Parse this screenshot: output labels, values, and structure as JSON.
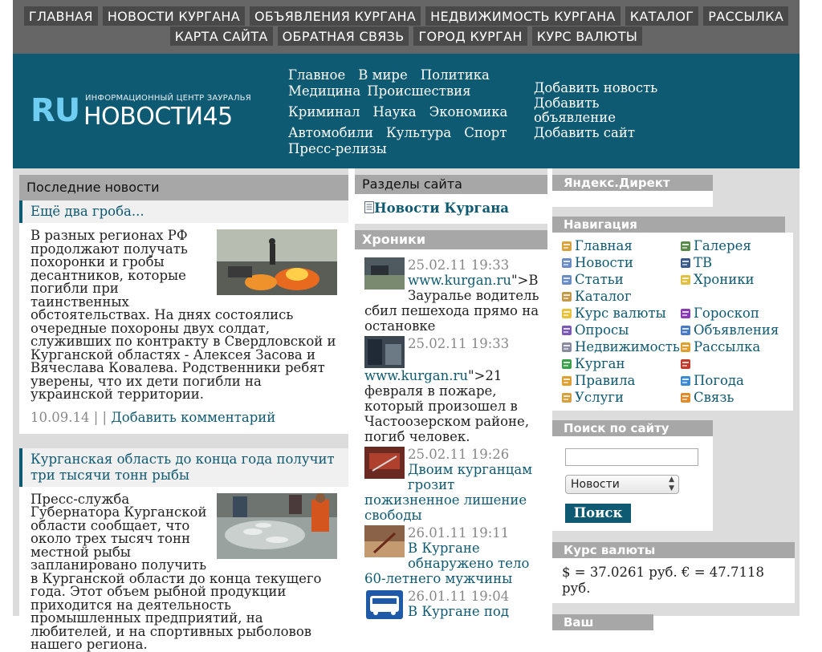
{
  "topnav": {
    "row1": [
      "ГЛАВНАЯ",
      "НОВОСТИ КУРГАНА",
      "ОБЪЯВЛЕНИЯ КУРГАНА",
      "НЕДВИЖИМОСТЬ КУРГАНА",
      "КАТАЛОГ",
      "РАССЫЛКА"
    ],
    "row2": [
      "КАРТА САЙТА",
      "ОБРАТНАЯ СВЯЗЬ",
      "ГОРОД КУРГАН",
      "КУРС ВАЛЮТЫ"
    ]
  },
  "logo": {
    "prefix": "RU",
    "name": "НОВОСТИ45",
    "tagline": "ИНФОРМАЦИОННЫЙ ЦЕНТР ЗАУРАЛЬЯ"
  },
  "categories": {
    "line1": [
      "Главное",
      "В мире",
      "Политика"
    ],
    "line2": [
      "Медицина",
      "Происшествия"
    ],
    "line3": [
      "Криминал",
      "Наука",
      "Экономика"
    ],
    "line4": [
      "Автомобили",
      "Культура",
      "Спорт"
    ],
    "line5": [
      "Пресс-релизы"
    ]
  },
  "header_links": {
    "add_news": "Добавить новость",
    "add_ad_1": "Добавить",
    "add_ad_2": "объявление",
    "add_site": "Добавить сайт"
  },
  "latest": {
    "title": "Последние новости",
    "items": [
      {
        "headline": "Ещё два гроба...",
        "text": "В разных регионах РФ продолжают получать похоронки и гробы десантников, которые погибли при таинственных обстоятельствах. На днях состоялись очередные похороны двух солдат, служивших по контракту в Свердловской и Курганской областях - Алексея Засова и Вячеслава Ковалева. Родственники ребят уверены, что их дети погибли на украинской территории.",
        "meta": "10.09.14 | |",
        "comment": "Добавить комментарий"
      },
      {
        "headline": "Курганская область до конца года получит три тысячи тонн рыбы",
        "text": "Пресс-служба Губернатора Курганской области сообщает, что около трех тысяч тонн местной рыбы запланировано получить в Курганской области до конца текущего года. Этот объем рыбной продукции приходится на деятельность промышленных предприятий, на любителей, и на спортивных рыболовов нашего региона."
      }
    ]
  },
  "sections": {
    "title": "Разделы сайта",
    "link": "Новости Кургана"
  },
  "chronicles": {
    "title": "Хроники",
    "items": [
      {
        "date": "25.02.11 19:33",
        "link": "www.kurgan.ru",
        "text": "\">В Зауралье водитель сбил пешехода прямо на остановке"
      },
      {
        "date": "25.02.11 19:33",
        "link": "www.kurgan.ru",
        "text": "\">21 февраля в пожаре, который произошел в Частоозерском районе, погиб человек."
      },
      {
        "date": "25.02.11 19:26",
        "link": "Двоим курганцам грозит пожизненное лишение свободы",
        "text": ""
      },
      {
        "date": "26.01.11 19:11",
        "link": "В Кургане обнаружено тело 60-летнего мужчины",
        "text": ""
      },
      {
        "date": "26.01.11 19:04",
        "link": "В Кургане под",
        "text": ""
      }
    ]
  },
  "yandex": {
    "title": "Яндекс.Директ"
  },
  "navigation": {
    "title": "Навигация",
    "left": [
      "Главная",
      "Новости",
      "Статьи",
      "Каталог",
      "Курс валюты",
      "Опросы",
      "Недвижимость",
      "Курган",
      "Правила",
      "Услуги"
    ],
    "right": [
      "Галерея",
      "ТВ",
      "Хроники",
      "",
      "Гороскоп",
      "Объявления",
      "Рассылка",
      "",
      "Погода",
      "Связь"
    ],
    "left_icons": [
      "home-icon",
      "document-icon",
      "document-icon",
      "catalog-icon",
      "smiley-icon",
      "poll-icon",
      "buildings-icon",
      "map-icon",
      "rules-icon",
      "services-icon"
    ],
    "right_icons": [
      "gallery-icon",
      "tv-icon",
      "note-icon",
      "",
      "zodiac-icon",
      "ads-icon",
      "mail-icon",
      "car-icon",
      "weather-icon",
      "contact-icon"
    ]
  },
  "search": {
    "title": "Поиск по сайту",
    "input_value": "",
    "select_value": "Новости",
    "button": "Поиск"
  },
  "currency": {
    "title": "Курс валюты",
    "text": "$ = 37.0261 руб. € = 47.7118 руб."
  },
  "horoscope": {
    "title": "Ваш гороскоп"
  },
  "colors": {
    "accent": "#0f5a73",
    "logo_ru": "#6fcdf2",
    "nav_bg": "#666666",
    "nav_item_bg": "#494949",
    "panel_head": "#a7a7a7"
  }
}
